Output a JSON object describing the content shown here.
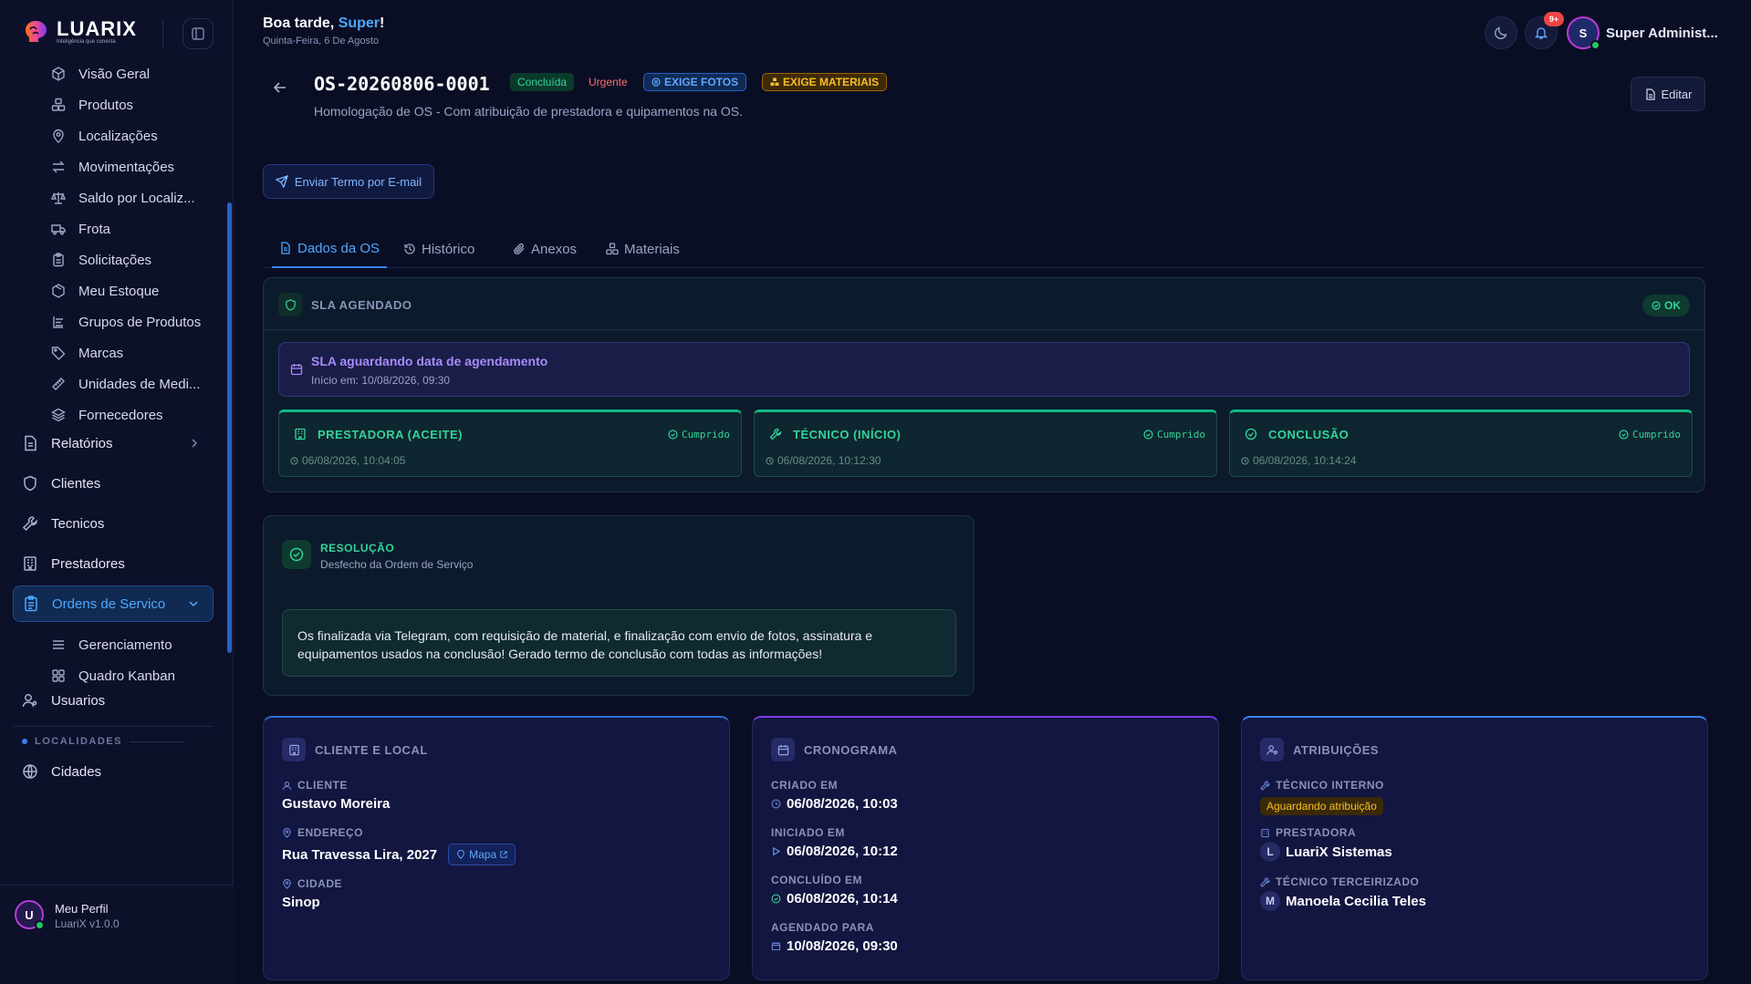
{
  "brand": {
    "name": "LUARIX",
    "tagline": "Inteligência que conecta"
  },
  "header": {
    "greeting_prefix": "Boa tarde, ",
    "greeting_name": "Super",
    "greeting_suffix": "!",
    "date": "Quinta-Feira, 6 De Agosto",
    "notification_count": "9+",
    "user_initial": "S",
    "user_name": "Super Administ..."
  },
  "sidebar": {
    "sub_items_top": [
      {
        "label": "Visão Geral",
        "icon": "cube-icon"
      },
      {
        "label": "Produtos",
        "icon": "boxes-icon"
      },
      {
        "label": "Localizações",
        "icon": "map-pin-icon"
      },
      {
        "label": "Movimentações",
        "icon": "arrows-icon"
      },
      {
        "label": "Saldo por Localiz...",
        "icon": "scale-icon"
      },
      {
        "label": "Frota",
        "icon": "truck-icon"
      },
      {
        "label": "Solicitações",
        "icon": "clipboard-icon"
      },
      {
        "label": "Meu Estoque",
        "icon": "package-icon"
      },
      {
        "label": "Grupos de Produtos",
        "icon": "group-icon"
      },
      {
        "label": "Marcas",
        "icon": "tag-icon"
      },
      {
        "label": "Unidades de Medi...",
        "icon": "ruler-icon"
      },
      {
        "label": "Fornecedores",
        "icon": "layers-icon"
      }
    ],
    "main_items": [
      {
        "label": "Relatórios",
        "icon": "report-icon"
      },
      {
        "label": "Clientes",
        "icon": "shield-icon"
      },
      {
        "label": "Tecnicos",
        "icon": "wrench-icon"
      },
      {
        "label": "Prestadores",
        "icon": "building-icon"
      },
      {
        "label": "Ordens de Servico",
        "icon": "clipboard-list-icon"
      }
    ],
    "os_sub_items": [
      {
        "label": "Gerenciamento",
        "icon": "list-icon"
      },
      {
        "label": "Quadro Kanban",
        "icon": "grid-icon"
      }
    ],
    "usuarios": "Usuarios",
    "section_localidades": "LOCALIDADES",
    "cidades": "Cidades",
    "profile": {
      "initial": "U",
      "name": "Meu Perfil",
      "version": "LuariX v1.0.0"
    }
  },
  "os": {
    "code": "OS-20260806-0001",
    "status": "Concluída",
    "priority": "Urgente",
    "badge_photos": "EXIGE FOTOS",
    "badge_materials": "EXIGE MATERIAIS",
    "description": "Homologação de OS - Com atribuição de prestadora e quipamentos na OS.",
    "edit_label": "Editar",
    "email_label": "Enviar Termo por E-mail"
  },
  "tabs": [
    {
      "label": "Dados da OS",
      "icon": "doc-icon"
    },
    {
      "label": "Histórico",
      "icon": "history-icon"
    },
    {
      "label": "Anexos",
      "icon": "paperclip-icon"
    },
    {
      "label": "Materiais",
      "icon": "boxes-icon"
    }
  ],
  "sla": {
    "title": "SLA AGENDADO",
    "status": "OK",
    "wait_title": "SLA aguardando data de agendamento",
    "wait_sub": "Início em: 10/08/2026, 09:30",
    "stages": [
      {
        "title": "PRESTADORA (ACEITE)",
        "status": "Cumprido",
        "time": "06/08/2026, 10:04:05",
        "icon": "building-icon"
      },
      {
        "title": "TÉCNICO (INÍCIO)",
        "status": "Cumprido",
        "time": "06/08/2026, 10:12:30",
        "icon": "wrench-icon"
      },
      {
        "title": "CONCLUSÃO",
        "status": "Cumprido",
        "time": "06/08/2026, 10:14:24",
        "icon": "check-circle-icon"
      }
    ]
  },
  "resolution": {
    "title": "RESOLUÇÃO",
    "subtitle": "Desfecho da Ordem de Serviço",
    "text": "Os finalizada via Telegram, com requisição de material, e finalização com envio de fotos, assinatura e equipamentos usados na conclusão! Gerado termo de conclusão com todas as informações!"
  },
  "client_card": {
    "title": "CLIENTE E LOCAL",
    "client_label": "CLIENTE",
    "client_value": "Gustavo Moreira",
    "address_label": "ENDEREÇO",
    "address_value": "Rua Travessa Lira, 2027",
    "map_label": "Mapa",
    "city_label": "CIDADE",
    "city_value": "Sinop"
  },
  "schedule_card": {
    "title": "CRONOGRAMA",
    "created_label": "CRIADO EM",
    "created_value": "06/08/2026, 10:03",
    "started_label": "INICIADO EM",
    "started_value": "06/08/2026, 10:12",
    "concluded_label": "CONCLUÍDO EM",
    "concluded_value": "06/08/2026, 10:14",
    "scheduled_label": "AGENDADO PARA",
    "scheduled_value": "10/08/2026, 09:30"
  },
  "assign_card": {
    "title": "ATRIBUIÇÕES",
    "internal_label": "TÉCNICO INTERNO",
    "internal_value": "Aguardando atribuição",
    "provider_label": "PRESTADORA",
    "provider_initial": "L",
    "provider_value": "LuariX Sistemas",
    "outsourced_label": "TÉCNICO TERCEIRIZADO",
    "outsourced_initial": "M",
    "outsourced_value": "Manoela Cecilia Teles"
  },
  "colors": {
    "accent": "#3b82f6",
    "success": "#34d399",
    "warning": "#fbbf24",
    "danger": "#ef4444",
    "purple": "#a78bfa"
  }
}
